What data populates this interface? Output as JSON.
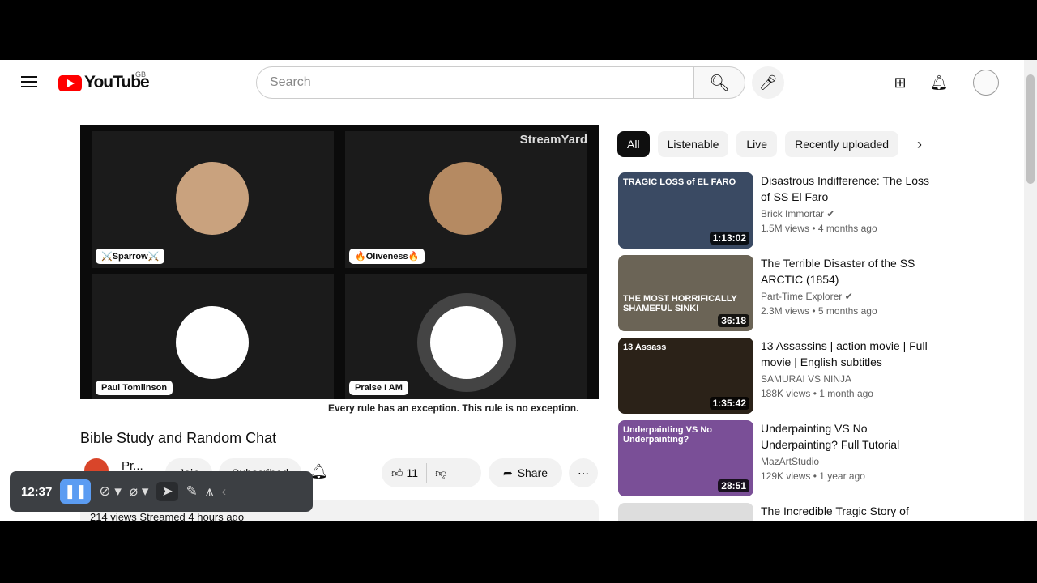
{
  "header": {
    "logo": "YouTube",
    "region": "GB",
    "search_placeholder": "Search"
  },
  "player": {
    "watermark": "StreamYard",
    "participants": [
      "⚔️Sparrow⚔️",
      "🔥Oliveness🔥",
      "Paul Tomlinson",
      "Praise I AM"
    ],
    "caption": "Every rule has an exception. This rule is no exception."
  },
  "video": {
    "title": "Bible Study and Random Chat",
    "channel": "Pr...",
    "join": "Join",
    "subscribed": "Subscribed",
    "likes": "11",
    "share": "Share",
    "meta": "214 views  Streamed 4 hours ago"
  },
  "toolbar": {
    "time": "12:37"
  },
  "chips": [
    "All",
    "Listenable",
    "Live",
    "Recently uploaded"
  ],
  "recommendations": [
    {
      "title": "Disastrous Indifference: The Loss of SS El Faro",
      "channel": "Brick Immortar",
      "verified": true,
      "views": "1.5M views",
      "age": "4 months ago",
      "duration": "1:13:02",
      "thumb_text": "TRAGIC LOSS of EL FARO"
    },
    {
      "title": "The Terrible Disaster of the SS ARCTIC (1854)",
      "channel": "Part-Time Explorer",
      "verified": true,
      "views": "2.3M views",
      "age": "5 months ago",
      "duration": "36:18",
      "thumb_text": "THE MOST HORRIFICALLY SHAMEFUL SINKI"
    },
    {
      "title": "13 Assassins | action movie | Full movie | English subtitles",
      "channel": "SAMURAI VS NINJA",
      "verified": false,
      "views": "188K views",
      "age": "1 month ago",
      "duration": "1:35:42",
      "thumb_text": "13 Assass"
    },
    {
      "title": "Underpainting VS No Underpainting? Full Tutorial",
      "channel": "MazArtStudio",
      "verified": false,
      "views": "129K views",
      "age": "1 year ago",
      "duration": "28:51",
      "thumb_text": "Underpainting VS No Underpainting?"
    },
    {
      "title": "The Incredible Tragic Story of",
      "channel": "",
      "views": "",
      "age": "",
      "duration": ""
    }
  ]
}
